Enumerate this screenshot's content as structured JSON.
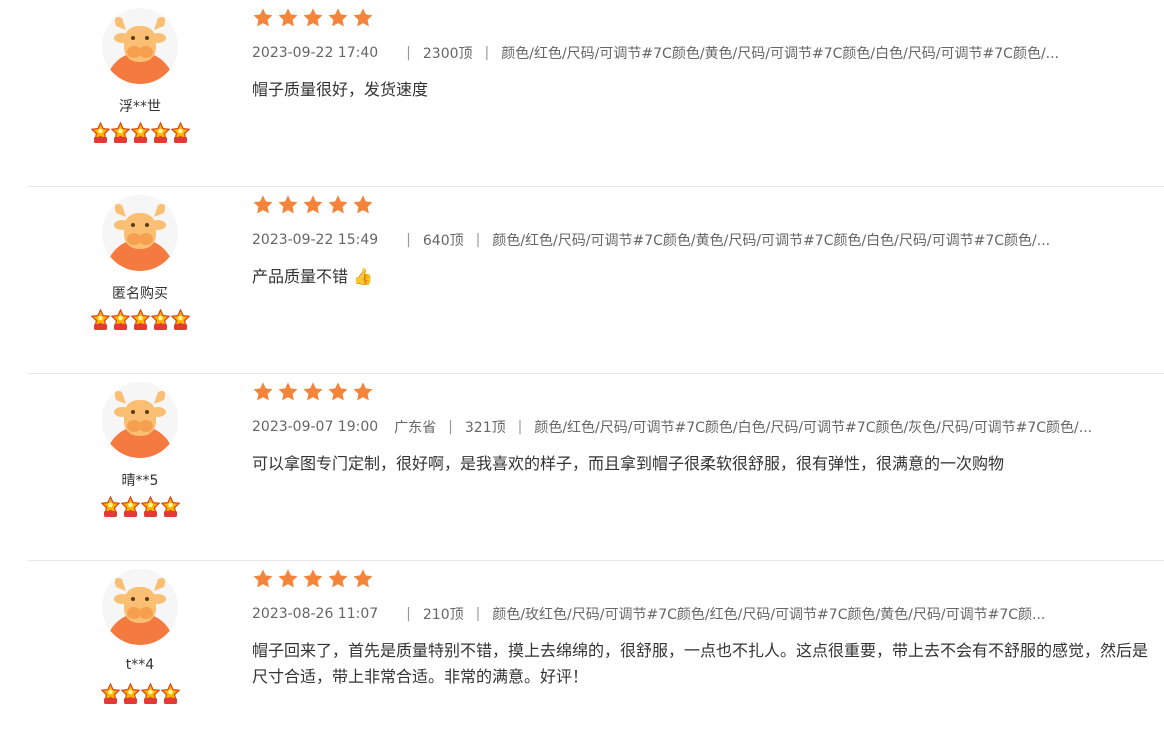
{
  "colors": {
    "star": "#f5843b",
    "avatar_body": "#f47a3f",
    "avatar_face": "#fbbf73",
    "divider": "#e8e8e8"
  },
  "icons": {
    "rating": "star-icon",
    "level": "level-badge-icon",
    "avatar": "cow-avatar-icon"
  },
  "reviews": [
    {
      "nickname": "浮**世",
      "level": 5,
      "rating": 5,
      "date": "2023-09-22 17:40",
      "region": "",
      "likes": "2300顶",
      "variant": "颜色/红色/尺码/可调节#7C颜色/黄色/尺码/可调节#7C颜色/白色/尺码/可调节#7C颜色/...",
      "text": "帽子质量很好，发货速度",
      "emoji": ""
    },
    {
      "nickname": "匿名购买",
      "level": 5,
      "rating": 5,
      "date": "2023-09-22 15:49",
      "region": "",
      "likes": "640顶",
      "variant": "颜色/红色/尺码/可调节#7C颜色/黄色/尺码/可调节#7C颜色/白色/尺码/可调节#7C颜色/...",
      "text": "产品质量不错",
      "emoji": "👍"
    },
    {
      "nickname": "晴**5",
      "level": 4,
      "rating": 5,
      "date": "2023-09-07 19:00",
      "region": "广东省",
      "likes": "321顶",
      "variant": "颜色/红色/尺码/可调节#7C颜色/白色/尺码/可调节#7C颜色/灰色/尺码/可调节#7C颜色/...",
      "text": "可以拿图专门定制，很好啊，是我喜欢的样子，而且拿到帽子很柔软很舒服，很有弹性，很满意的一次购物",
      "emoji": ""
    },
    {
      "nickname": "t**4",
      "level": 4,
      "rating": 5,
      "date": "2023-08-26 11:07",
      "region": "",
      "likes": "210顶",
      "variant": "颜色/玫红色/尺码/可调节#7C颜色/红色/尺码/可调节#7C颜色/黄色/尺码/可调节#7C颜...",
      "text": "帽子回来了，首先是质量特别不错，摸上去绵绵的，很舒服，一点也不扎人。这点很重要，带上去不会有不舒服的感觉，然后是尺寸合适，带上非常合适。非常的满意。好评！",
      "emoji": ""
    }
  ]
}
